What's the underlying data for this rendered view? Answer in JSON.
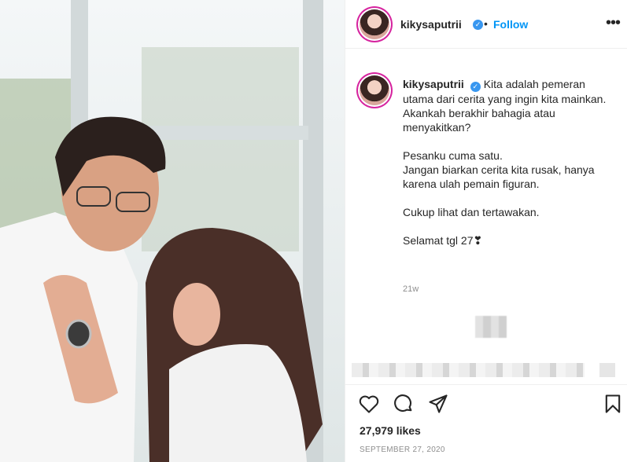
{
  "post": {
    "username": "kikysaputrii",
    "verified": true,
    "follow_label": "Follow",
    "separator": "•",
    "more_label": "•••",
    "caption": "Kita adalah pemeran utama dari cerita yang ingin kita mainkan.\nAkankah berakhir bahagia atau menyakitkan?\n\nPesanku cuma satu.\nJangan biarkan cerita kita rusak, hanya karena ulah pemain figuran.\n\nCukup lihat dan tertawakan.\n\nSelamat tgl 27❣",
    "time_ago": "21w",
    "likes": "27,979 likes",
    "date": "September 27, 2020"
  },
  "icons": {
    "like": "heart-icon",
    "comment": "comment-icon",
    "share": "share-icon",
    "save": "bookmark-icon",
    "verified": "verified-badge-icon"
  },
  "colors": {
    "accent": "#0095f6",
    "verified": "#3897f0",
    "text": "#262626",
    "muted": "#8e8e8e"
  }
}
